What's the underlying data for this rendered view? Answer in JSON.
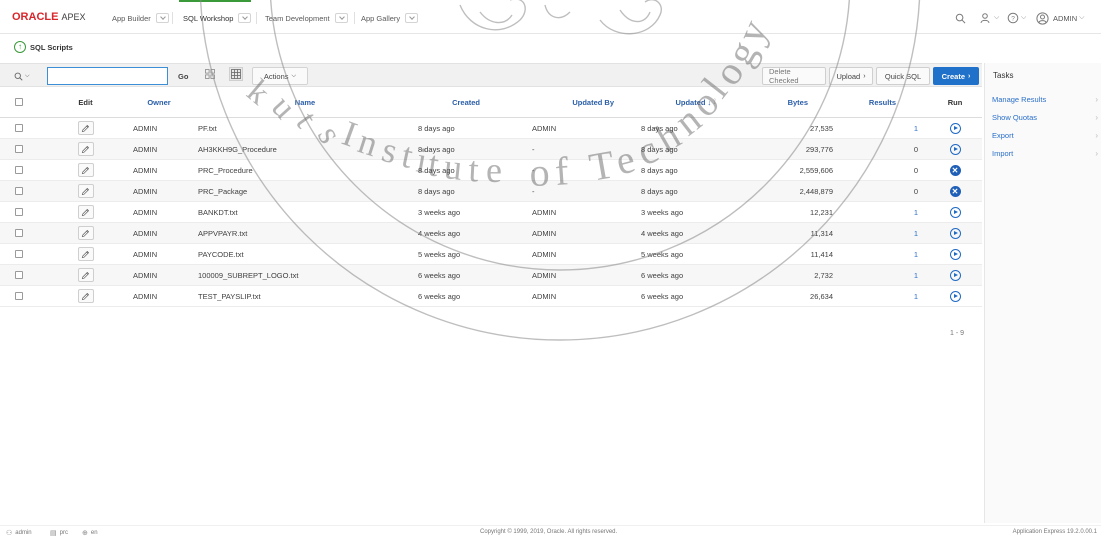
{
  "app": {
    "brand": "ORACLE",
    "product": "APEX",
    "brand_color": "#d8262b"
  },
  "nav": {
    "tabs": [
      {
        "label": "App Builder"
      },
      {
        "label": "SQL Workshop"
      },
      {
        "label": "Team Development"
      },
      {
        "label": "App Gallery"
      }
    ],
    "active_tab": "SQL Workshop",
    "user_label": "ADMIN"
  },
  "breadcrumb": {
    "title": "SQL Scripts"
  },
  "toolbar": {
    "search_value": "",
    "go_label": "Go",
    "actions_label": "Actions",
    "delete_label": "Delete Checked",
    "upload_label": "Upload",
    "quick_sql_label": "Quick SQL",
    "create_label": "Create",
    "create_color": "#1f71c9"
  },
  "table": {
    "headers": {
      "edit": "Edit",
      "owner": "Owner",
      "name": "Name",
      "created": "Created",
      "updated_by": "Updated By",
      "updated": "Updated",
      "bytes": "Bytes",
      "results": "Results",
      "run": "Run"
    },
    "rows": [
      {
        "owner": "ADMIN",
        "name": "PF.txt",
        "created": "8 days ago",
        "updated_by": "ADMIN",
        "updated": "8 days ago",
        "bytes": "27,535",
        "results": "1",
        "run": "play"
      },
      {
        "owner": "ADMIN",
        "name": "AH3KKH9G_Procedure",
        "created": "8 days ago",
        "updated_by": "-",
        "updated": "8 days ago",
        "bytes": "293,776",
        "results": "0",
        "run": "play"
      },
      {
        "owner": "ADMIN",
        "name": "PRC_Procedure",
        "created": "8 days ago",
        "updated_by": "-",
        "updated": "8 days ago",
        "bytes": "2,559,606",
        "results": "0",
        "run": "error"
      },
      {
        "owner": "ADMIN",
        "name": "PRC_Package",
        "created": "8 days ago",
        "updated_by": "-",
        "updated": "8 days ago",
        "bytes": "2,448,879",
        "results": "0",
        "run": "error"
      },
      {
        "owner": "ADMIN",
        "name": "BANKDT.txt",
        "created": "3 weeks ago",
        "updated_by": "ADMIN",
        "updated": "3 weeks ago",
        "bytes": "12,231",
        "results": "1",
        "run": "play"
      },
      {
        "owner": "ADMIN",
        "name": "APPVPAYR.txt",
        "created": "4 weeks ago",
        "updated_by": "ADMIN",
        "updated": "4 weeks ago",
        "bytes": "11,314",
        "results": "1",
        "run": "play"
      },
      {
        "owner": "ADMIN",
        "name": "PAYCODE.txt",
        "created": "5 weeks ago",
        "updated_by": "ADMIN",
        "updated": "5 weeks ago",
        "bytes": "11,414",
        "results": "1",
        "run": "play"
      },
      {
        "owner": "ADMIN",
        "name": "100009_SUBREPT_LOGO.txt",
        "created": "6 weeks ago",
        "updated_by": "ADMIN",
        "updated": "6 weeks ago",
        "bytes": "2,732",
        "results": "1",
        "run": "play"
      },
      {
        "owner": "ADMIN",
        "name": "TEST_PAYSLIP.txt",
        "created": "6 weeks ago",
        "updated_by": "ADMIN",
        "updated": "6 weeks ago",
        "bytes": "26,634",
        "results": "1",
        "run": "play"
      }
    ],
    "pagination": "1 - 9"
  },
  "tasks": {
    "title": "Tasks",
    "links": [
      {
        "label": "Manage Results"
      },
      {
        "label": "Show Quotas"
      },
      {
        "label": "Export"
      },
      {
        "label": "Import"
      }
    ]
  },
  "footer": {
    "user": "admin",
    "schema": "prc",
    "language": "en",
    "copyright": "Copyright © 1999, 2019, Oracle. All rights reserved.",
    "version": "Application Express 19.2.0.00.1"
  },
  "watermark": {
    "text": "Institute of Technology"
  }
}
